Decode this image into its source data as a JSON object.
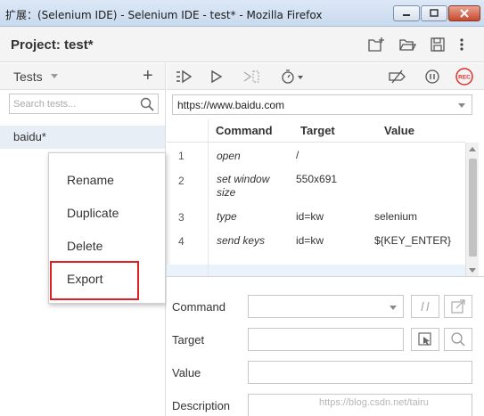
{
  "window": {
    "title": "扩展：(Selenium IDE) - Selenium IDE - test* - Mozilla Firefox"
  },
  "project": {
    "label": "Project:",
    "name": "test*"
  },
  "tests_panel": {
    "title": "Tests",
    "search_placeholder": "Search tests...",
    "items": [
      {
        "label": "baidu*"
      }
    ]
  },
  "context_menu": {
    "items": [
      {
        "label": "Rename"
      },
      {
        "label": "Duplicate"
      },
      {
        "label": "Delete"
      },
      {
        "label": "Export"
      }
    ],
    "highlighted": "Export"
  },
  "editor": {
    "url": "https://www.baidu.com",
    "columns": [
      "Command",
      "Target",
      "Value"
    ],
    "rows": [
      {
        "num": "1",
        "command": "open",
        "target": "/",
        "value": ""
      },
      {
        "num": "2",
        "command": "set window size",
        "target": "550x691",
        "value": ""
      },
      {
        "num": "3",
        "command": "type",
        "target": "id=kw",
        "value": "selenium"
      },
      {
        "num": "4",
        "command": "send keys",
        "target": "id=kw",
        "value": "${KEY_ENTER}"
      }
    ]
  },
  "properties": {
    "command_label": "Command",
    "target_label": "Target",
    "value_label": "Value",
    "description_label": "Description"
  },
  "icons": {
    "rec_color": "#e0302c",
    "rec_text": "REC"
  },
  "watermark": "https://blog.csdn.net/tairu"
}
